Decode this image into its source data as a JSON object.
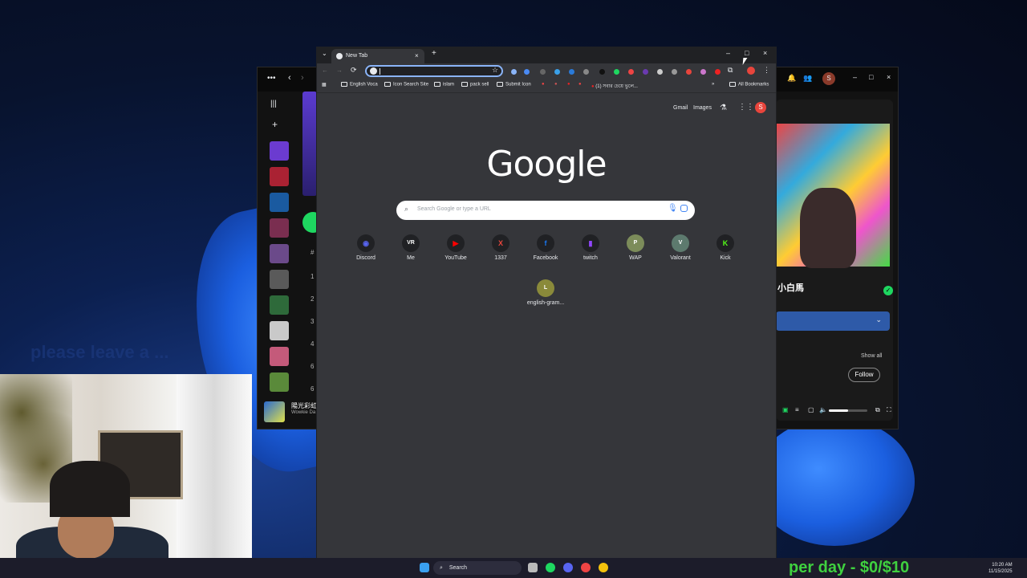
{
  "overlay": {
    "faded_text": "please leave a ...",
    "stream_goal": "per day - $0/$10"
  },
  "chrome": {
    "tab_title": "New Tab",
    "tab_close": "×",
    "new_tab": "+",
    "window": {
      "minimize": "–",
      "maximize": "□",
      "close": "×"
    },
    "nav": {
      "back": "←",
      "forward": "→",
      "reload": "⟳"
    },
    "bookmarks": [
      {
        "label": "English Voca",
        "type": "folder"
      },
      {
        "label": "Icon Search Site",
        "type": "folder"
      },
      {
        "label": "islam",
        "type": "folder"
      },
      {
        "label": "pack sell",
        "type": "folder"
      },
      {
        "label": "Submit Icon",
        "type": "folder"
      },
      {
        "label": "(1) সবার চেয়ে ভুলে...",
        "type": "link"
      }
    ],
    "bookmarks_more": "»",
    "all_bookmarks": "All Bookmarks",
    "top_links": {
      "gmail": "Gmail",
      "images": "Images",
      "avatar_letter": "S",
      "labs_icon": "flask-icon",
      "apps_icon": "apps-grid-icon"
    },
    "logo": "Google",
    "search_placeholder": "Search Google or type a URL",
    "shortcuts": [
      {
        "label": "Discord",
        "glyph": "◉",
        "color": "#5865f2"
      },
      {
        "label": "Me",
        "glyph": "VR",
        "color": "#ffffff"
      },
      {
        "label": "YouTube",
        "glyph": "▶",
        "color": "#ff0000"
      },
      {
        "label": "1337",
        "glyph": "X",
        "color": "#e8453c"
      },
      {
        "label": "Facebook",
        "glyph": "f",
        "color": "#1877f2"
      },
      {
        "label": "twitch",
        "glyph": "▮",
        "color": "#9146ff"
      },
      {
        "label": "WAP",
        "glyph": "P",
        "color": "#7c8c5a"
      },
      {
        "label": "Valorant",
        "glyph": "V",
        "color": "#5d7a6e"
      },
      {
        "label": "Kick",
        "glyph": "K",
        "color": "#53fc18"
      },
      {
        "label": "english-gram...",
        "glyph": "L",
        "color": "#8a8a3a"
      }
    ]
  },
  "spotify": {
    "right_title": "小白馬",
    "show_all": "Show all",
    "follow": "Follow",
    "now_playing_title": "陽光彩虹小白馬",
    "now_playing_artist": "Wowkie Da",
    "track_numbers": [
      "#",
      "1",
      "2",
      "3",
      "4",
      "6",
      "6"
    ]
  },
  "taskbar": {
    "search": "Search",
    "time": "10:20 AM",
    "date": "11/15/2025"
  }
}
